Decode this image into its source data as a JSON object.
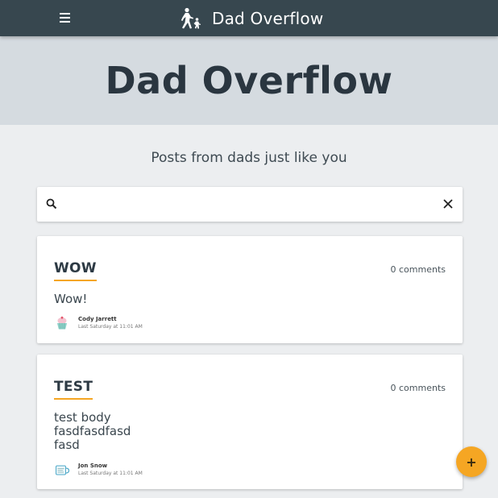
{
  "appbar": {
    "title": "Dad Overflow",
    "menu_icon": "hamburger-menu-icon",
    "brand_icon": "dad-walking-with-child-icon",
    "background": "#37474f"
  },
  "hero": {
    "heading": "Dad Overflow",
    "background": "#d5dbe0"
  },
  "subtitle": "Posts from dads just like you",
  "search": {
    "value": "",
    "placeholder": "",
    "icon": "search-icon",
    "clear_icon": "close-icon"
  },
  "posts": [
    {
      "title": "WOW",
      "comments": "0 comments",
      "body": "Wow!",
      "author": "Cody Jarrett",
      "time": "Last Saturday at 11:01 AM",
      "avatar_icon": "cupcake-avatar-icon"
    },
    {
      "title": "TEST",
      "comments": "0 comments",
      "body": "test body\nfasdfasdfasd\nfasd",
      "author": "Jon Snow",
      "time": "Last Saturday at 11:01 AM",
      "avatar_icon": "mug-avatar-icon"
    }
  ],
  "fab": {
    "label": "+",
    "icon": "add-icon"
  },
  "colors": {
    "accent": "#f5a623",
    "page_background": "#eceef0"
  }
}
